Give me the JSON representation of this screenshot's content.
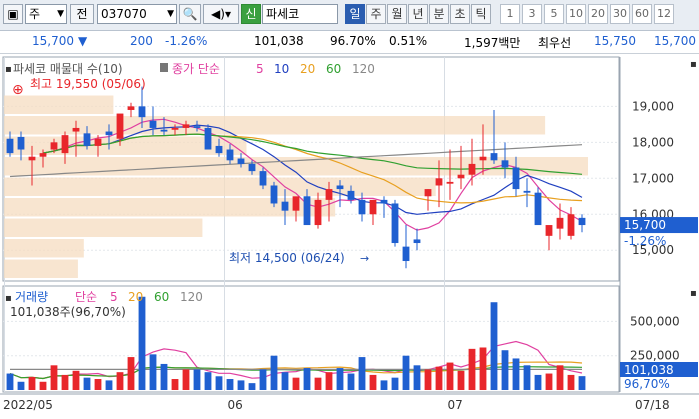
{
  "toolbar": {
    "market_label": "주",
    "search_label": "전",
    "code_value": "037070",
    "stock_name": "파세코",
    "stock_badge": "신",
    "period_tabs": [
      "일",
      "주",
      "월",
      "년",
      "분",
      "초",
      "틱"
    ],
    "active_tab": "일",
    "interval_buttons": [
      "1",
      "3",
      "5",
      "10",
      "20",
      "30",
      "60",
      "12"
    ]
  },
  "info": {
    "price": "15,700",
    "direction": "▼",
    "change": "200",
    "change_pct": "-1.26%",
    "volume": "101,038",
    "volume_ratio": "96.70%",
    "turnover": "0.51%",
    "trade_value": "1,597백만",
    "best_ask_label": "최우선",
    "best_ask": "15,750",
    "best_bid": "15,700"
  },
  "price_panel": {
    "legend_profile": "파세코 매물대 수(10)",
    "legend_ma_title": "종가 단순",
    "legend_ma_periods": [
      "5",
      "10",
      "20",
      "60",
      "120"
    ],
    "high_label": "최고 19,550 (05/06)",
    "low_label": "최저 14,500 (06/24)",
    "current_price_tag": "15,700",
    "current_change_tag": "-1.26%",
    "y_axis_labels": [
      "19,000",
      "18,000",
      "17,000",
      "16,000",
      "15,000"
    ]
  },
  "volume_panel": {
    "legend_title": "거래량",
    "legend_ma_title": "단순",
    "legend_ma_periods": [
      "5",
      "20",
      "60",
      "120"
    ],
    "volume_info": "101,038주(96,70%)",
    "current_volume_tag": "101,038",
    "current_ratio_tag": "96,70%",
    "y_axis_labels": [
      "500,000",
      "250,000"
    ]
  },
  "x_axis_labels": [
    "2022/05",
    "06",
    "07",
    "07/18"
  ],
  "colors": {
    "up": "#e8262b",
    "down": "#1f5fd0",
    "ma5": "#e040a0",
    "ma10": "#2040c0",
    "ma20": "#e8a020",
    "ma60": "#30a030",
    "ma120": "#888888",
    "profile": "#f5dcc0"
  },
  "chart_data": {
    "type": "candlestick",
    "dates": [
      "05/02",
      "05/03",
      "05/04",
      "05/06",
      "05/09",
      "05/10",
      "05/11",
      "05/12",
      "05/13",
      "05/16",
      "05/17",
      "05/18",
      "05/19",
      "05/20",
      "05/23",
      "05/24",
      "05/25",
      "05/26",
      "05/27",
      "05/30",
      "05/31",
      "06/02",
      "06/03",
      "06/07",
      "06/08",
      "06/09",
      "06/10",
      "06/13",
      "06/14",
      "06/15",
      "06/16",
      "06/17",
      "06/20",
      "06/21",
      "06/22",
      "06/23",
      "06/24",
      "06/27",
      "06/28",
      "06/29",
      "06/30",
      "07/01",
      "07/04",
      "07/05",
      "07/06",
      "07/07",
      "07/08",
      "07/11",
      "07/12",
      "07/13",
      "07/14",
      "07/15",
      "07/18"
    ],
    "open": [
      18100,
      18150,
      17500,
      17600,
      17800,
      17700,
      18300,
      18250,
      17900,
      18300,
      18100,
      18900,
      19000,
      18600,
      18350,
      18350,
      18400,
      18450,
      18400,
      17900,
      17800,
      17550,
      17400,
      17200,
      16800,
      16350,
      16100,
      16500,
      15700,
      16400,
      16800,
      16650,
      16400,
      16000,
      16400,
      16300,
      15100,
      15300,
      16500,
      16800,
      16850,
      17000,
      17100,
      17500,
      17700,
      17500,
      17300,
      16650,
      16600,
      15400,
      15600,
      15400,
      15900
    ],
    "high": [
      18300,
      18300,
      17900,
      17800,
      18100,
      18300,
      18600,
      18450,
      18200,
      18500,
      18700,
      19100,
      19550,
      19000,
      18700,
      18500,
      18600,
      18600,
      18500,
      18100,
      17950,
      17700,
      17500,
      17300,
      16900,
      16700,
      16400,
      16700,
      16600,
      16900,
      16950,
      16800,
      16600,
      16400,
      16500,
      16400,
      15700,
      15600,
      16700,
      17500,
      17800,
      17900,
      18100,
      18500,
      18900,
      18000,
      17600,
      17000,
      16750,
      15500,
      16300,
      16200,
      16000
    ],
    "low": [
      17600,
      17500,
      16800,
      17300,
      17700,
      17400,
      17600,
      17800,
      17600,
      17800,
      17900,
      18700,
      18400,
      18200,
      18200,
      18200,
      18200,
      18300,
      17800,
      17600,
      17400,
      17300,
      17100,
      16700,
      16200,
      15700,
      15800,
      16000,
      15600,
      15800,
      16200,
      16300,
      15800,
      15700,
      15900,
      15100,
      14500,
      15000,
      16100,
      16200,
      16400,
      16700,
      16800,
      17100,
      17400,
      17000,
      16500,
      16200,
      15900,
      15000,
      15300,
      15300,
      15500
    ],
    "close": [
      17700,
      17800,
      17600,
      17700,
      18000,
      18200,
      18400,
      17900,
      18100,
      18200,
      18800,
      19000,
      18700,
      18400,
      18300,
      18400,
      18500,
      18400,
      17800,
      17700,
      17500,
      17400,
      17200,
      16800,
      16300,
      16100,
      16500,
      15700,
      16400,
      16700,
      16700,
      16400,
      16000,
      16400,
      16300,
      15200,
      14700,
      15200,
      16700,
      17000,
      16900,
      17100,
      17400,
      17600,
      17500,
      17300,
      16700,
      16600,
      15700,
      15700,
      15900,
      16000,
      15700
    ],
    "volume": [
      120000,
      60000,
      95000,
      60000,
      180000,
      110000,
      140000,
      90000,
      80000,
      70000,
      130000,
      240000,
      680000,
      260000,
      190000,
      80000,
      150000,
      150000,
      130000,
      100000,
      80000,
      70000,
      50000,
      150000,
      250000,
      130000,
      90000,
      160000,
      90000,
      130000,
      160000,
      120000,
      240000,
      110000,
      70000,
      90000,
      250000,
      180000,
      150000,
      170000,
      200000,
      140000,
      300000,
      310000,
      640000,
      290000,
      230000,
      180000,
      110000,
      120000,
      180000,
      110000,
      101038
    ],
    "ylim": [
      14200,
      19900
    ],
    "volume_ylim": [
      0,
      700000
    ]
  }
}
